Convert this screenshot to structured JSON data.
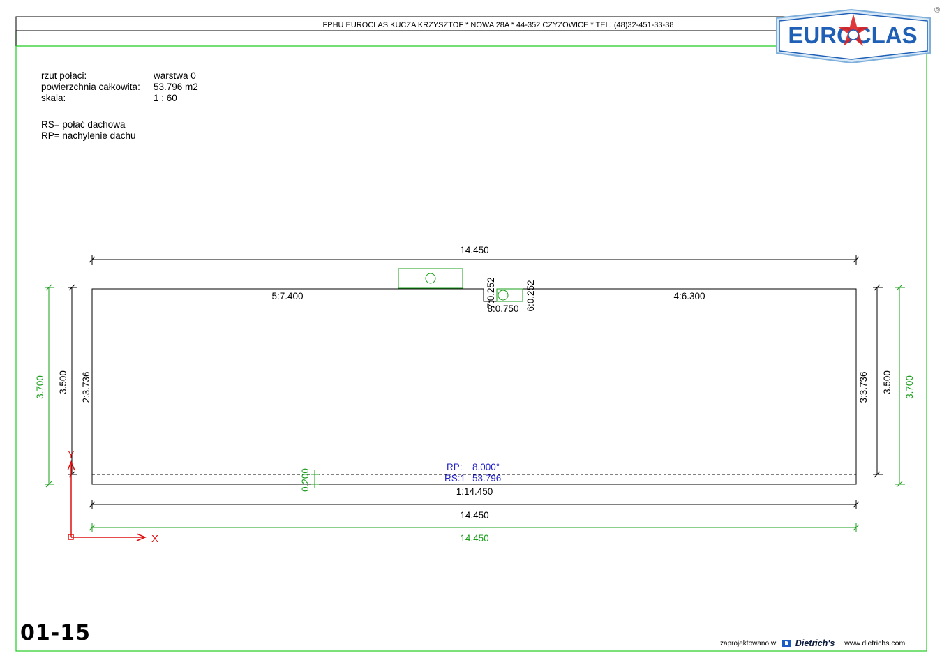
{
  "header": {
    "company_line": "FPHU EUROCLAS KUCZA KRZYSZTOF * NOWA 28A * 44-352 CZYZOWICE * TEL. (48)32-451-33-38",
    "logo_text": "EUROCLAS",
    "registered_mark": "®"
  },
  "info": {
    "rows": [
      {
        "label": "rzut połaci:",
        "value": "warstwa 0"
      },
      {
        "label": "powierzchnia całkowita:",
        "value": "53.796 m2"
      },
      {
        "label": "skala:",
        "value": "1 : 60"
      }
    ],
    "legend": [
      "RS= połać dachowa",
      "RP= nachylenie dachu"
    ]
  },
  "drawing": {
    "top_total": "14.450",
    "edge_5": "5:7.400",
    "edge_4": "4:6.300",
    "edge_7": "7:0.252",
    "edge_8": "8:0.750",
    "edge_6": "6:0.252",
    "left_green": "3.700",
    "left_black": "3.500",
    "edge_2": "2:3.736",
    "right_edge_3": "3:3.736",
    "right_black": "3.500",
    "right_green": "3.700",
    "rp_label": "RP:",
    "rp_value": "8.000°",
    "rs_label": "RS:1",
    "rs_value": "53.796",
    "overhang": "0.200",
    "edge_1": "1:14.450",
    "bottom_black": "14.450",
    "bottom_green": "14.450",
    "axis_x": "X",
    "axis_y": "Y"
  },
  "footer": {
    "sheet_number": "01-15",
    "designed_in": "zaprojektowano w:",
    "software": "Dietrich's",
    "url": "www.dietrichs.com"
  },
  "colors": {
    "frame_green": "#22cc22",
    "dim_green": "#1a9e1a",
    "blue_text": "#2323c8",
    "axis_red": "#dd1111",
    "logo_blue": "#1f5fb5"
  }
}
